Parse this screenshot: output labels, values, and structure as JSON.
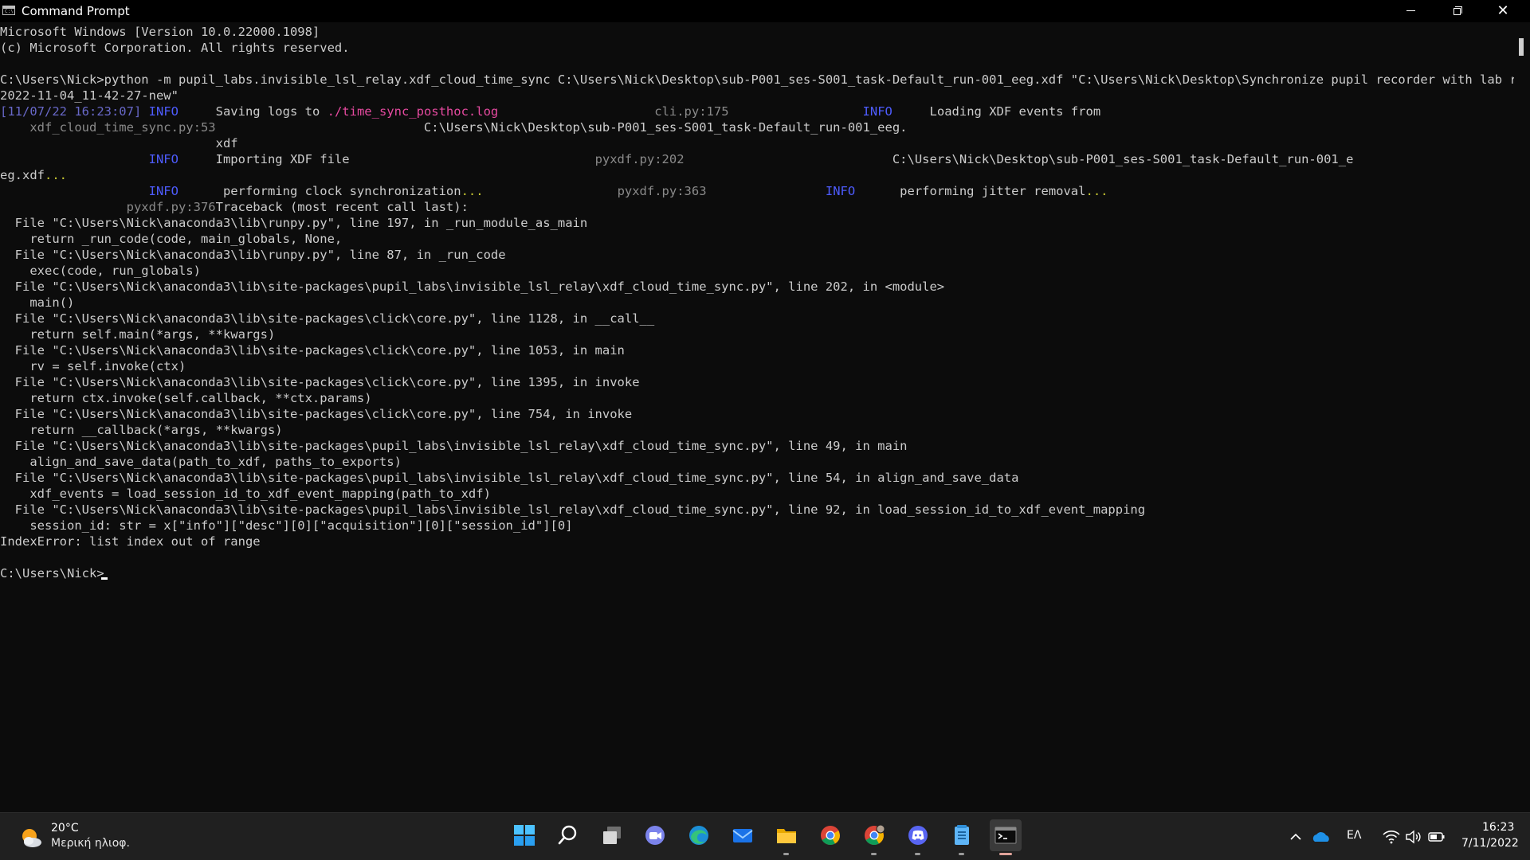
{
  "window": {
    "title": "Command Prompt",
    "icon_text": "C:\\"
  },
  "console": {
    "lines": [
      {
        "segs": [
          [
            "",
            "Microsoft Windows [Version 10.0.22000.1098]"
          ]
        ]
      },
      {
        "segs": [
          [
            "",
            "(c) Microsoft Corporation. All rights reserved."
          ]
        ]
      },
      {
        "segs": [
          [
            "",
            ""
          ]
        ]
      },
      {
        "segs": [
          [
            "",
            "C:\\Users\\Nick>python -m pupil_labs.invisible_lsl_relay.xdf_cloud_time_sync C:\\Users\\Nick\\Desktop\\sub-P001_ses-S001_task-Default_run-001_eeg.xdf \"C:\\Users\\Nick\\Desktop\\Synchronize pupil recorder with lab recoder\\"
          ]
        ]
      },
      {
        "segs": [
          [
            "",
            "2022-11-04_11-42-27-new\""
          ]
        ]
      },
      {
        "segs": [
          [
            "ts",
            "[11/07/22 16:23:07]"
          ],
          [
            "",
            " "
          ],
          [
            "info",
            "INFO"
          ],
          [
            "",
            "     Saving logs to "
          ],
          [
            "mag",
            "./time_sync_posthoc.log"
          ],
          [
            "",
            "                     "
          ],
          [
            "dim",
            "cli.py:175"
          ],
          [
            "",
            "                  "
          ],
          [
            "info",
            "INFO"
          ],
          [
            "",
            "     Loading XDF events from"
          ]
        ]
      },
      {
        "segs": [
          [
            "",
            "    "
          ],
          [
            "dim",
            "xdf_cloud_time_sync.py:53"
          ],
          [
            "",
            "                            C:\\Users\\Nick\\Desktop\\sub-P001_ses-S001_task-Default_run-001_eeg."
          ]
        ]
      },
      {
        "segs": [
          [
            "",
            "                             xdf"
          ]
        ]
      },
      {
        "segs": [
          [
            "",
            "                    "
          ],
          [
            "info",
            "INFO"
          ],
          [
            "",
            "     Importing XDF file                                 "
          ],
          [
            "dim",
            "pyxdf.py:202"
          ],
          [
            "",
            "                            C:\\Users\\Nick\\Desktop\\sub-P001_ses-S001_task-Default_run-001_e"
          ]
        ]
      },
      {
        "segs": [
          [
            "",
            "eg.xdf"
          ],
          [
            "yel",
            "..."
          ]
        ]
      },
      {
        "segs": [
          [
            "",
            "                    "
          ],
          [
            "info",
            "INFO"
          ],
          [
            "",
            "      performing clock synchronization"
          ],
          [
            "yel",
            "..."
          ],
          [
            "",
            "                  "
          ],
          [
            "dim",
            "pyxdf.py:363"
          ],
          [
            "",
            "                "
          ],
          [
            "info",
            "INFO"
          ],
          [
            "",
            "      performing jitter removal"
          ],
          [
            "yel",
            "..."
          ]
        ]
      },
      {
        "segs": [
          [
            "",
            "                 "
          ],
          [
            "dim",
            "pyxdf.py:376"
          ],
          [
            "",
            "Traceback (most recent call last):"
          ]
        ]
      },
      {
        "segs": [
          [
            "",
            "  File \"C:\\Users\\Nick\\anaconda3\\lib\\runpy.py\", line 197, in _run_module_as_main"
          ]
        ]
      },
      {
        "segs": [
          [
            "",
            "    return _run_code(code, main_globals, None,"
          ]
        ]
      },
      {
        "segs": [
          [
            "",
            "  File \"C:\\Users\\Nick\\anaconda3\\lib\\runpy.py\", line 87, in _run_code"
          ]
        ]
      },
      {
        "segs": [
          [
            "",
            "    exec(code, run_globals)"
          ]
        ]
      },
      {
        "segs": [
          [
            "",
            "  File \"C:\\Users\\Nick\\anaconda3\\lib\\site-packages\\pupil_labs\\invisible_lsl_relay\\xdf_cloud_time_sync.py\", line 202, in <module>"
          ]
        ]
      },
      {
        "segs": [
          [
            "",
            "    main()"
          ]
        ]
      },
      {
        "segs": [
          [
            "",
            "  File \"C:\\Users\\Nick\\anaconda3\\lib\\site-packages\\click\\core.py\", line 1128, in __call__"
          ]
        ]
      },
      {
        "segs": [
          [
            "",
            "    return self.main(*args, **kwargs)"
          ]
        ]
      },
      {
        "segs": [
          [
            "",
            "  File \"C:\\Users\\Nick\\anaconda3\\lib\\site-packages\\click\\core.py\", line 1053, in main"
          ]
        ]
      },
      {
        "segs": [
          [
            "",
            "    rv = self.invoke(ctx)"
          ]
        ]
      },
      {
        "segs": [
          [
            "",
            "  File \"C:\\Users\\Nick\\anaconda3\\lib\\site-packages\\click\\core.py\", line 1395, in invoke"
          ]
        ]
      },
      {
        "segs": [
          [
            "",
            "    return ctx.invoke(self.callback, **ctx.params)"
          ]
        ]
      },
      {
        "segs": [
          [
            "",
            "  File \"C:\\Users\\Nick\\anaconda3\\lib\\site-packages\\click\\core.py\", line 754, in invoke"
          ]
        ]
      },
      {
        "segs": [
          [
            "",
            "    return __callback(*args, **kwargs)"
          ]
        ]
      },
      {
        "segs": [
          [
            "",
            "  File \"C:\\Users\\Nick\\anaconda3\\lib\\site-packages\\pupil_labs\\invisible_lsl_relay\\xdf_cloud_time_sync.py\", line 49, in main"
          ]
        ]
      },
      {
        "segs": [
          [
            "",
            "    align_and_save_data(path_to_xdf, paths_to_exports)"
          ]
        ]
      },
      {
        "segs": [
          [
            "",
            "  File \"C:\\Users\\Nick\\anaconda3\\lib\\site-packages\\pupil_labs\\invisible_lsl_relay\\xdf_cloud_time_sync.py\", line 54, in align_and_save_data"
          ]
        ]
      },
      {
        "segs": [
          [
            "",
            "    xdf_events = load_session_id_to_xdf_event_mapping(path_to_xdf)"
          ]
        ]
      },
      {
        "segs": [
          [
            "",
            "  File \"C:\\Users\\Nick\\anaconda3\\lib\\site-packages\\pupil_labs\\invisible_lsl_relay\\xdf_cloud_time_sync.py\", line 92, in load_session_id_to_xdf_event_mapping"
          ]
        ]
      },
      {
        "segs": [
          [
            "",
            "    session_id: str = x[\"info\"][\"desc\"][0][\"acquisition\"][0][\"session_id\"][0]"
          ]
        ]
      },
      {
        "segs": [
          [
            "",
            "IndexError: list index out of range"
          ]
        ]
      },
      {
        "segs": [
          [
            "",
            ""
          ]
        ]
      },
      {
        "segs": [
          [
            "",
            "C:\\Users\\Nick>"
          ]
        ]
      }
    ]
  },
  "taskbar": {
    "weather": {
      "temp": "20°C",
      "desc": "Μερική ηλιοφ."
    },
    "apps": [
      {
        "name": "start-button",
        "icon": "windows-logo-icon"
      },
      {
        "name": "search-button",
        "icon": "search-icon"
      },
      {
        "name": "task-view-button",
        "icon": "task-view-icon"
      },
      {
        "name": "teams-chat-button",
        "icon": "teams-chat-icon"
      },
      {
        "name": "edge-button",
        "icon": "edge-icon"
      },
      {
        "name": "mail-button",
        "icon": "mail-icon"
      },
      {
        "name": "file-explorer-button",
        "icon": "folder-icon"
      },
      {
        "name": "chrome-button",
        "icon": "chrome-icon"
      },
      {
        "name": "chrome-profile-button",
        "icon": "chrome-profile-icon"
      },
      {
        "name": "discord-button",
        "icon": "discord-icon"
      },
      {
        "name": "notepad-button",
        "icon": "notepad-icon"
      },
      {
        "name": "terminal-button",
        "icon": "terminal-icon"
      }
    ],
    "tray": {
      "language": "ΕΛ",
      "time": "16:23",
      "date": "7/11/2022"
    }
  },
  "colors": {
    "console_bg": "#0c0c0c",
    "console_fg": "#cccccc",
    "info": "#4e5cff",
    "log_path": "#e64aa0",
    "taskbar_bg": "#202020"
  }
}
